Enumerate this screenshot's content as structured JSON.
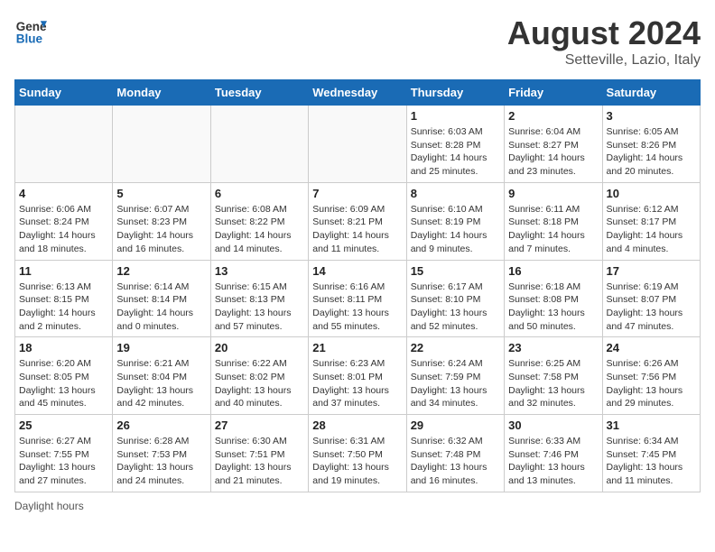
{
  "header": {
    "logo_line1": "General",
    "logo_line2": "Blue",
    "month_year": "August 2024",
    "location": "Setteville, Lazio, Italy"
  },
  "days_of_week": [
    "Sunday",
    "Monday",
    "Tuesday",
    "Wednesday",
    "Thursday",
    "Friday",
    "Saturday"
  ],
  "weeks": [
    [
      {
        "day": "",
        "info": ""
      },
      {
        "day": "",
        "info": ""
      },
      {
        "day": "",
        "info": ""
      },
      {
        "day": "",
        "info": ""
      },
      {
        "day": "1",
        "info": "Sunrise: 6:03 AM\nSunset: 8:28 PM\nDaylight: 14 hours and 25 minutes."
      },
      {
        "day": "2",
        "info": "Sunrise: 6:04 AM\nSunset: 8:27 PM\nDaylight: 14 hours and 23 minutes."
      },
      {
        "day": "3",
        "info": "Sunrise: 6:05 AM\nSunset: 8:26 PM\nDaylight: 14 hours and 20 minutes."
      }
    ],
    [
      {
        "day": "4",
        "info": "Sunrise: 6:06 AM\nSunset: 8:24 PM\nDaylight: 14 hours and 18 minutes."
      },
      {
        "day": "5",
        "info": "Sunrise: 6:07 AM\nSunset: 8:23 PM\nDaylight: 14 hours and 16 minutes."
      },
      {
        "day": "6",
        "info": "Sunrise: 6:08 AM\nSunset: 8:22 PM\nDaylight: 14 hours and 14 minutes."
      },
      {
        "day": "7",
        "info": "Sunrise: 6:09 AM\nSunset: 8:21 PM\nDaylight: 14 hours and 11 minutes."
      },
      {
        "day": "8",
        "info": "Sunrise: 6:10 AM\nSunset: 8:19 PM\nDaylight: 14 hours and 9 minutes."
      },
      {
        "day": "9",
        "info": "Sunrise: 6:11 AM\nSunset: 8:18 PM\nDaylight: 14 hours and 7 minutes."
      },
      {
        "day": "10",
        "info": "Sunrise: 6:12 AM\nSunset: 8:17 PM\nDaylight: 14 hours and 4 minutes."
      }
    ],
    [
      {
        "day": "11",
        "info": "Sunrise: 6:13 AM\nSunset: 8:15 PM\nDaylight: 14 hours and 2 minutes."
      },
      {
        "day": "12",
        "info": "Sunrise: 6:14 AM\nSunset: 8:14 PM\nDaylight: 14 hours and 0 minutes."
      },
      {
        "day": "13",
        "info": "Sunrise: 6:15 AM\nSunset: 8:13 PM\nDaylight: 13 hours and 57 minutes."
      },
      {
        "day": "14",
        "info": "Sunrise: 6:16 AM\nSunset: 8:11 PM\nDaylight: 13 hours and 55 minutes."
      },
      {
        "day": "15",
        "info": "Sunrise: 6:17 AM\nSunset: 8:10 PM\nDaylight: 13 hours and 52 minutes."
      },
      {
        "day": "16",
        "info": "Sunrise: 6:18 AM\nSunset: 8:08 PM\nDaylight: 13 hours and 50 minutes."
      },
      {
        "day": "17",
        "info": "Sunrise: 6:19 AM\nSunset: 8:07 PM\nDaylight: 13 hours and 47 minutes."
      }
    ],
    [
      {
        "day": "18",
        "info": "Sunrise: 6:20 AM\nSunset: 8:05 PM\nDaylight: 13 hours and 45 minutes."
      },
      {
        "day": "19",
        "info": "Sunrise: 6:21 AM\nSunset: 8:04 PM\nDaylight: 13 hours and 42 minutes."
      },
      {
        "day": "20",
        "info": "Sunrise: 6:22 AM\nSunset: 8:02 PM\nDaylight: 13 hours and 40 minutes."
      },
      {
        "day": "21",
        "info": "Sunrise: 6:23 AM\nSunset: 8:01 PM\nDaylight: 13 hours and 37 minutes."
      },
      {
        "day": "22",
        "info": "Sunrise: 6:24 AM\nSunset: 7:59 PM\nDaylight: 13 hours and 34 minutes."
      },
      {
        "day": "23",
        "info": "Sunrise: 6:25 AM\nSunset: 7:58 PM\nDaylight: 13 hours and 32 minutes."
      },
      {
        "day": "24",
        "info": "Sunrise: 6:26 AM\nSunset: 7:56 PM\nDaylight: 13 hours and 29 minutes."
      }
    ],
    [
      {
        "day": "25",
        "info": "Sunrise: 6:27 AM\nSunset: 7:55 PM\nDaylight: 13 hours and 27 minutes."
      },
      {
        "day": "26",
        "info": "Sunrise: 6:28 AM\nSunset: 7:53 PM\nDaylight: 13 hours and 24 minutes."
      },
      {
        "day": "27",
        "info": "Sunrise: 6:30 AM\nSunset: 7:51 PM\nDaylight: 13 hours and 21 minutes."
      },
      {
        "day": "28",
        "info": "Sunrise: 6:31 AM\nSunset: 7:50 PM\nDaylight: 13 hours and 19 minutes."
      },
      {
        "day": "29",
        "info": "Sunrise: 6:32 AM\nSunset: 7:48 PM\nDaylight: 13 hours and 16 minutes."
      },
      {
        "day": "30",
        "info": "Sunrise: 6:33 AM\nSunset: 7:46 PM\nDaylight: 13 hours and 13 minutes."
      },
      {
        "day": "31",
        "info": "Sunrise: 6:34 AM\nSunset: 7:45 PM\nDaylight: 13 hours and 11 minutes."
      }
    ]
  ],
  "footer": {
    "note": "Daylight hours"
  }
}
